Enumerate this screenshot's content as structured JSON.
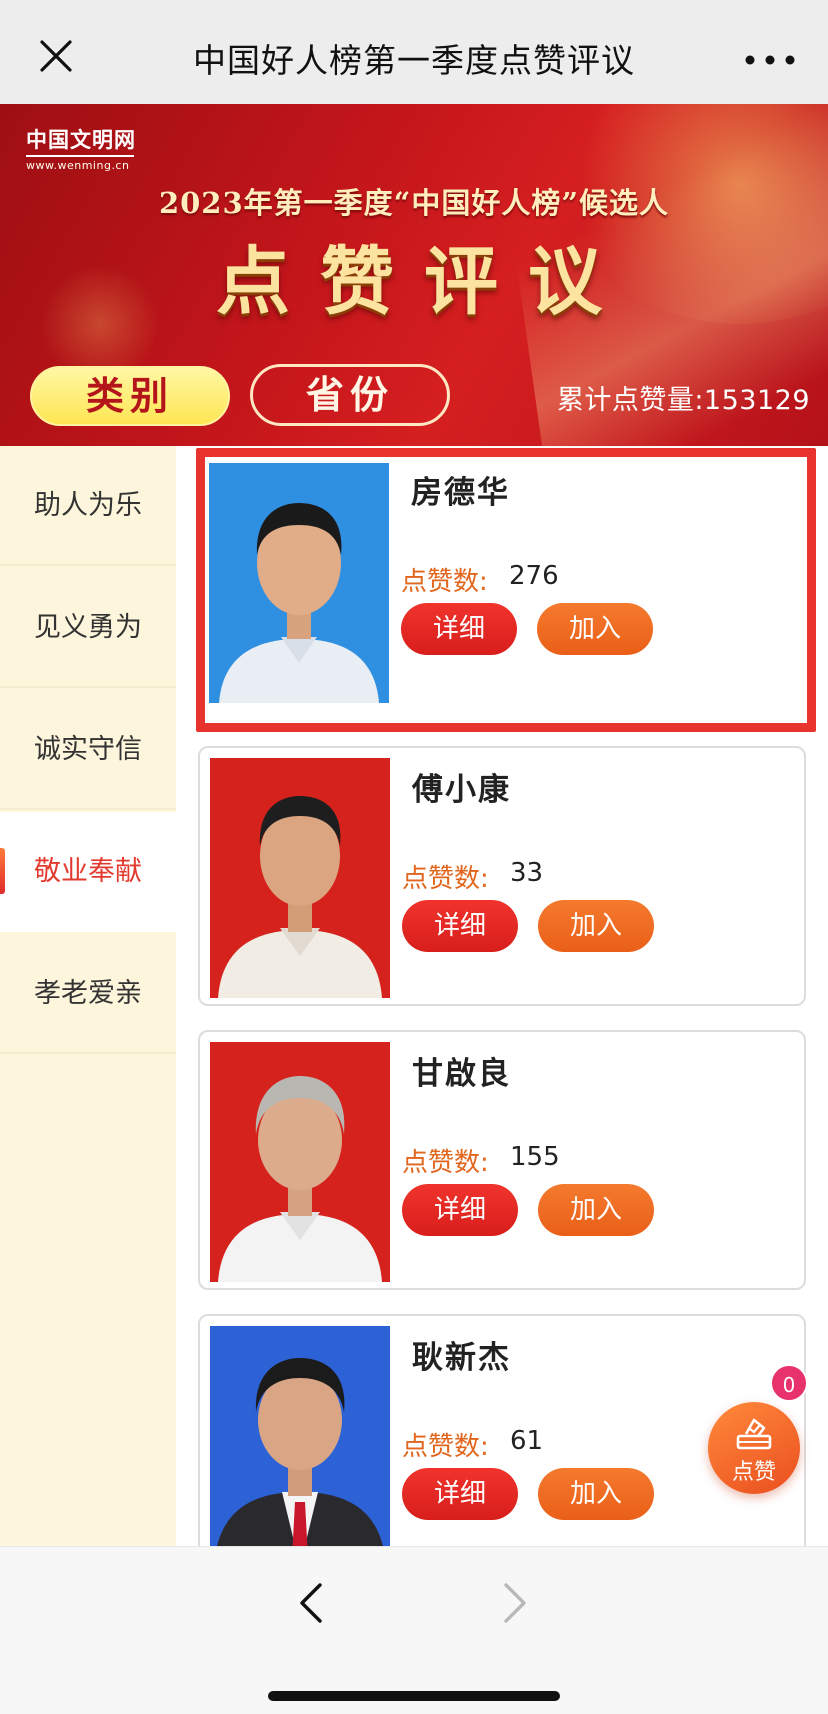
{
  "navbar": {
    "title": "中国好人榜第一季度点赞评议",
    "close_icon": "close-icon",
    "more_icon": "more-dots-icon"
  },
  "banner": {
    "brand_cn": "中国文明网",
    "brand_en": "www.wenming.cn",
    "subtitle": "2023年第一季度“中国好人榜”候选人",
    "title": "点赞评议",
    "category_button": "类别",
    "province_button": "省份",
    "total_likes": "累计点赞量:153129"
  },
  "sidebar": {
    "items": [
      {
        "label": "助人为乐",
        "active": false
      },
      {
        "label": "见义勇为",
        "active": false
      },
      {
        "label": "诚实守信",
        "active": false
      },
      {
        "label": "敬业奉献",
        "active": true
      },
      {
        "label": "孝老爱亲",
        "active": false
      }
    ]
  },
  "candidates": [
    {
      "name": "房德华",
      "votes_label": "点赞数:",
      "votes": "276",
      "detail_label": "详细",
      "join_label": "加入",
      "photo_bg": "#2f8fe0",
      "selected": true
    },
    {
      "name": "傅小康",
      "votes_label": "点赞数:",
      "votes": "33",
      "detail_label": "详细",
      "join_label": "加入",
      "photo_bg": "#d6221c",
      "selected": false
    },
    {
      "name": "甘啟良",
      "votes_label": "点赞数:",
      "votes": "155",
      "detail_label": "详细",
      "join_label": "加入",
      "photo_bg": "#d6221c",
      "selected": false
    },
    {
      "name": "耿新杰",
      "votes_label": "点赞数:",
      "votes": "61",
      "detail_label": "详细",
      "join_label": "加入",
      "photo_bg": "#2c62d6",
      "selected": false
    }
  ],
  "fab": {
    "label": "点赞",
    "badge": "0",
    "icon": "vote-ballot-icon"
  },
  "bottom_nav": {
    "back_icon": "chevron-left-icon",
    "forward_icon": "chevron-right-icon"
  },
  "colors": {
    "accent_red": "#e8322c",
    "accent_orange": "#ea5f18",
    "sidebar_bg": "#fdf5dc"
  }
}
